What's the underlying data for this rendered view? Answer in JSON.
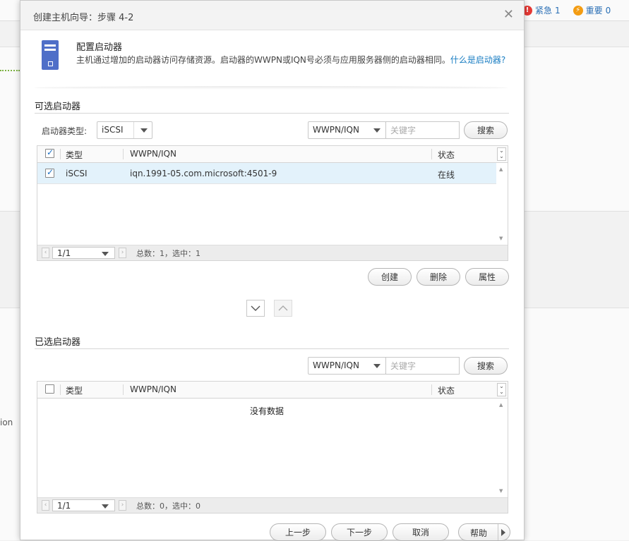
{
  "background": {
    "alerts": [
      {
        "icon": "urgent-alert-icon",
        "label": "紧急",
        "count": "1",
        "color": "#e53935"
      },
      {
        "icon": "important-alert-icon",
        "label": "重要",
        "count": "0",
        "color": "#f39c12"
      }
    ],
    "cut_text": "ion"
  },
  "dialog": {
    "title": "创建主机向导：步骤 4-2",
    "close_icon": "close-icon",
    "intro": {
      "icon": "server-icon",
      "title": "配置启动器",
      "description": "主机通过增加的启动器访问存储资源。启动器的WWPN或IQN号必须与应用服务器侧的启动器相同。",
      "link": "什么是启动器?"
    },
    "available": {
      "section_title": "可选启动器",
      "type_label": "启动器类型:",
      "type_value": "iSCSI",
      "filter_field": "WWPN/IQN",
      "keyword_placeholder": "关键字",
      "search_label": "搜索",
      "columns": {
        "type": "类型",
        "wwpn": "WWPN/IQN",
        "status": "状态"
      },
      "rows": [
        {
          "checked": true,
          "type": "iSCSI",
          "wwpn": "iqn.1991-05.com.microsoft:4501-9",
          "status": "在线"
        }
      ],
      "pager": {
        "page": "1/1",
        "info": "总数：1，选中：1"
      },
      "buttons": {
        "create": "创建",
        "delete": "删除",
        "properties": "属性"
      }
    },
    "selected": {
      "section_title": "已选启动器",
      "filter_field": "WWPN/IQN",
      "keyword_placeholder": "关键字",
      "search_label": "搜索",
      "columns": {
        "type": "类型",
        "wwpn": "WWPN/IQN",
        "status": "状态"
      },
      "empty_text": "没有数据",
      "pager": {
        "page": "1/1",
        "info": "总数：0，选中：0"
      }
    },
    "footer": {
      "prev": "上一步",
      "next": "下一步",
      "cancel": "取消",
      "help": "帮助"
    }
  }
}
